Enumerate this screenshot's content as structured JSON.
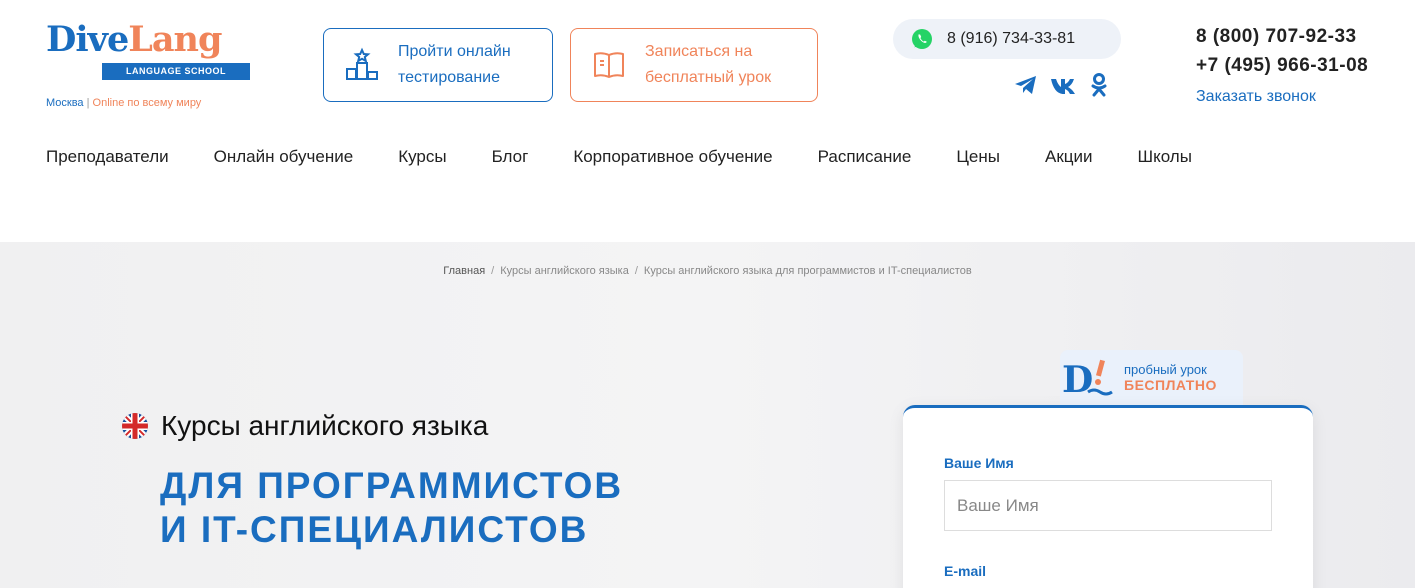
{
  "logo": {
    "word_d": "D",
    "word_ive": "ive",
    "word_lang": "Lang",
    "school": "LANGUAGE SCHOOL",
    "city": "Москва",
    "separator": "|",
    "online": "Online по всему миру"
  },
  "header": {
    "test_button": {
      "line1": "Пройти онлайн",
      "line2": "тестирование"
    },
    "trial_button": {
      "line1": "Записаться на",
      "line2": "бесплатный урок"
    },
    "whatsapp_phone": "8 (916) 734-33-81",
    "phone_main": "8 (800) 707-92-33",
    "phone_moscow": "+7 (495) 966-31-08",
    "callback": "Заказать звонок"
  },
  "nav": {
    "items": [
      {
        "label": "Преподаватели"
      },
      {
        "label": "Онлайн обучение"
      },
      {
        "label": "Курсы"
      },
      {
        "label": "Блог"
      },
      {
        "label": "Корпоративное обучение"
      },
      {
        "label": "Расписание"
      },
      {
        "label": "Цены"
      },
      {
        "label": "Акции"
      },
      {
        "label": "Школы"
      }
    ]
  },
  "breadcrumb": {
    "home": "Главная",
    "sep": "/",
    "level2": "Курсы английского языка",
    "level3": "Курсы английского языка для программистов и IT-специалистов"
  },
  "hero": {
    "subtitle": "Курсы английского языка",
    "title_line1": "ДЛЯ ПРОГРАММИСТОВ",
    "title_line2": "И IT-СПЕЦИАЛИСТОВ"
  },
  "form": {
    "badge_line1": "пробный урок",
    "badge_line2": "БЕСПЛАТНО",
    "name_label": "Ваше Имя",
    "name_placeholder": "Ваше Имя",
    "email_label": "E-mail"
  },
  "colors": {
    "brand_blue": "#1a6dbf",
    "brand_orange": "#f0845a",
    "whatsapp_green": "#25d366"
  }
}
